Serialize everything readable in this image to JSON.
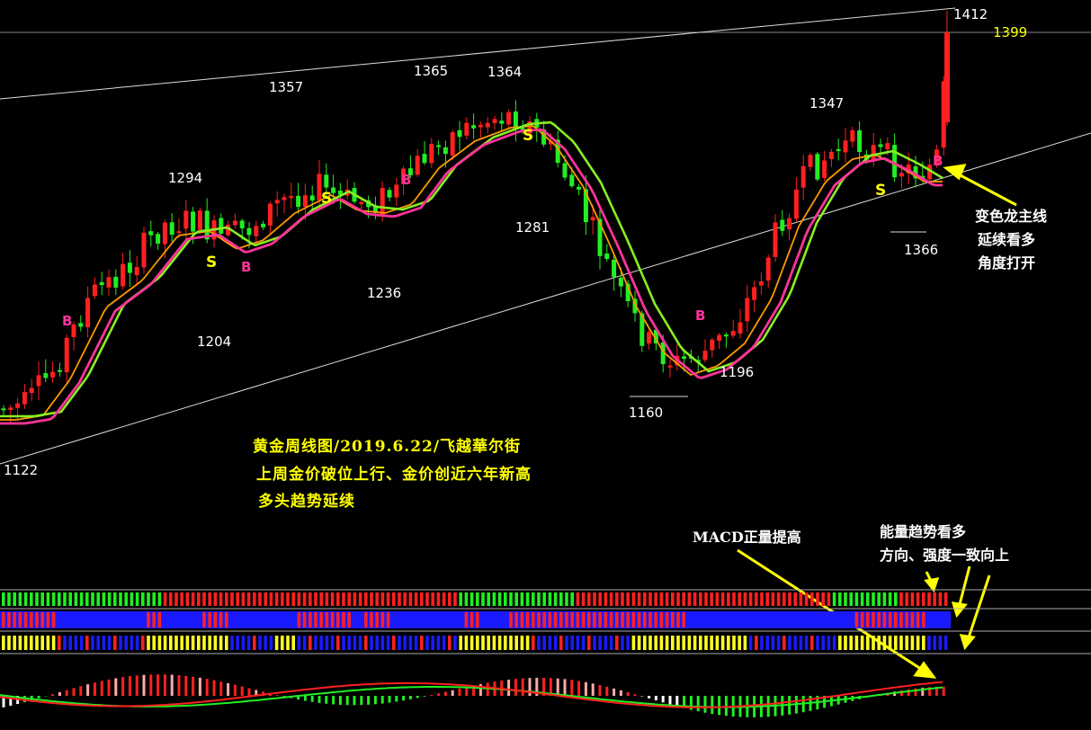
{
  "chart_data": {
    "type": "candlestick",
    "title_lines": [
      "黄金周线图/2019.6.22/飞越華尔街",
      "上周金价破位上行、金价创近六年新高",
      "多头趋势延续"
    ],
    "last_price": "1399",
    "price_labels": [
      {
        "text": "1122",
        "value": 1122
      },
      {
        "text": "1294",
        "value": 1294
      },
      {
        "text": "1204",
        "value": 1204
      },
      {
        "text": "1357",
        "value": 1357
      },
      {
        "text": "1236",
        "value": 1236
      },
      {
        "text": "1365",
        "value": 1365
      },
      {
        "text": "1364",
        "value": 1364
      },
      {
        "text": "1281",
        "value": 1281
      },
      {
        "text": "1160",
        "value": 1160
      },
      {
        "text": "1196",
        "value": 1196
      },
      {
        "text": "1347",
        "value": 1347
      },
      {
        "text": "1366",
        "value": 1366
      },
      {
        "text": "1412",
        "value": 1412
      }
    ],
    "signals": [
      {
        "text": "B",
        "color": "#ff3399"
      },
      {
        "text": "S",
        "color": "#ffff00"
      },
      {
        "text": "B",
        "color": "#ff3399"
      },
      {
        "text": "S",
        "color": "#ffff00"
      },
      {
        "text": "B",
        "color": "#ff3399"
      },
      {
        "text": "S",
        "color": "#ffff00"
      },
      {
        "text": "B",
        "color": "#ff3399"
      },
      {
        "text": "S",
        "color": "#ffff00"
      },
      {
        "text": "B",
        "color": "#ff3399"
      }
    ],
    "notes": {
      "dragon": [
        "变色龙主线",
        "延续看多",
        "角度打开"
      ],
      "macd": "MACD正量提高",
      "energy": [
        "能量趋势看多",
        "方向、强度一致向上"
      ]
    },
    "colors": {
      "up": "#ff2020",
      "down": "#22ee22",
      "ma_green": "#88ee22",
      "ma_orange": "#ff9900",
      "ma_pink": "#ff3399",
      "channel": "#ffffff",
      "arrow": "#ffff00",
      "panel_blue": "#1a1aff"
    }
  }
}
